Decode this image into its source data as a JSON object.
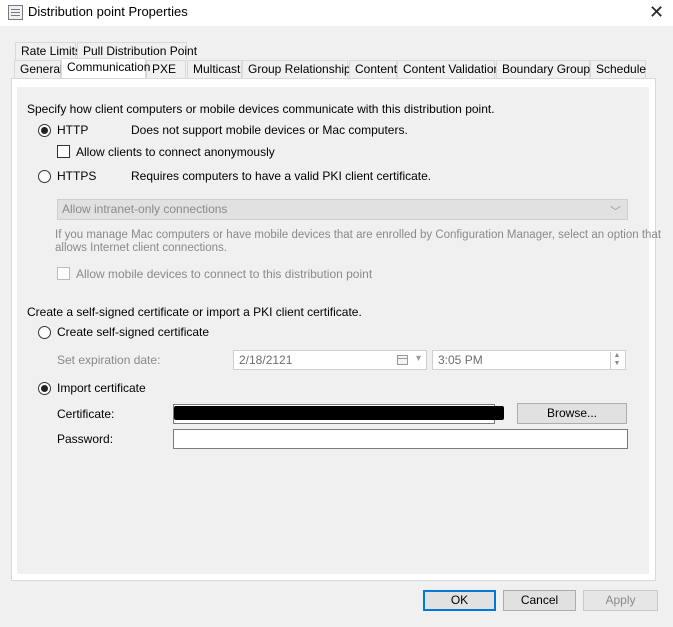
{
  "window": {
    "title": "Distribution point Properties",
    "close_glyph": "✕"
  },
  "tabs_row1": [
    "Rate Limits",
    "Pull Distribution Point"
  ],
  "tabs_row2": [
    "General",
    "Communication",
    "PXE",
    "Multicast",
    "Group Relationships",
    "Content",
    "Content Validation",
    "Boundary Groups",
    "Schedule"
  ],
  "active_tab": "Communication",
  "communication": {
    "intro": "Specify how client computers or mobile devices communicate with this distribution point.",
    "http_label": "HTTP",
    "http_desc": "Does not support mobile devices or Mac computers.",
    "anon_label": "Allow clients to connect anonymously",
    "https_label": "HTTPS",
    "https_desc": "Requires computers to have a valid PKI client certificate.",
    "intranet_select": "Allow intranet-only connections",
    "mac_note_line1": "If you manage Mac computers or have mobile devices that are enrolled by Configuration Manager, select an option that",
    "mac_note_line2": "allows Internet client connections.",
    "mobile_label": "Allow mobile devices to connect to this distribution point",
    "http_checked": true,
    "https_checked": false,
    "anon_checked": false
  },
  "certificate": {
    "intro": "Create a self-signed certificate or import a PKI client certificate.",
    "self_signed_label": "Create self-signed certificate",
    "expiration_label": "Set expiration date:",
    "expiration_date": "2/18/2121",
    "expiration_time": "3:05 PM",
    "import_label": "Import certificate",
    "certificate_label": "Certificate:",
    "certificate_value": "",
    "browse_label": "Browse...",
    "password_label": "Password:",
    "password_value": "",
    "self_signed_checked": false,
    "import_checked": true
  },
  "buttons": {
    "ok": "OK",
    "cancel": "Cancel",
    "apply": "Apply"
  }
}
